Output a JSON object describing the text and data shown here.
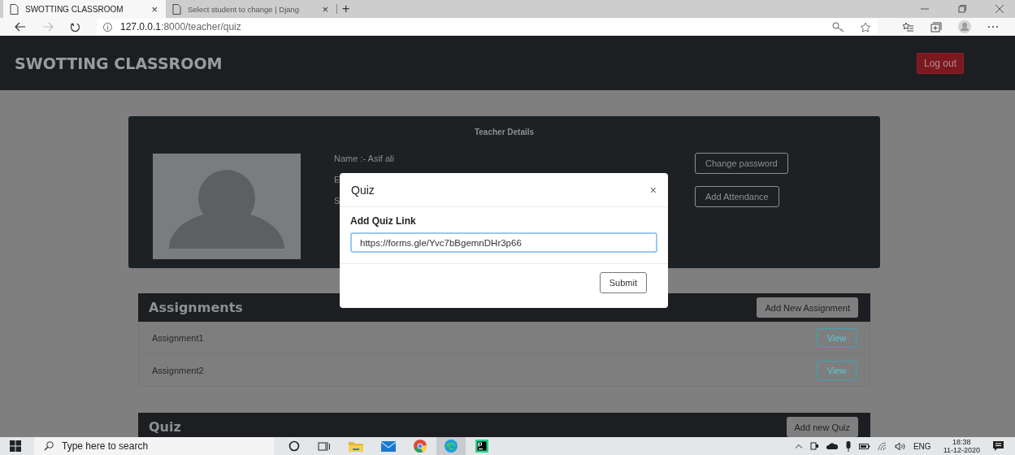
{
  "browser": {
    "tabs": [
      {
        "title": "SWOTTING CLASSROOM",
        "selected": true
      },
      {
        "title": "Select student to change | Djang",
        "selected": false
      }
    ],
    "close_tab": "×",
    "new_tab": "+",
    "address": {
      "host": "127.0.0.1",
      "path": ":8000/teacher/quiz"
    }
  },
  "navbar": {
    "brand": "SWOTTING CLASSROOM",
    "logout": "Log out"
  },
  "teacher": {
    "title": "Teacher Details",
    "details": [
      "Name :- Asif ali",
      "E",
      "S"
    ],
    "buttons": [
      "Change password",
      "Add Attendance"
    ]
  },
  "assignments": {
    "title": "Assignments",
    "add": "Add New Assignment",
    "rows": [
      {
        "name": "Assignment1",
        "action": "View"
      },
      {
        "name": "Assignment2",
        "action": "View"
      }
    ]
  },
  "quiz": {
    "title": "Quiz",
    "add": "Add new Quiz"
  },
  "modal": {
    "title": "Quiz",
    "close": "×",
    "label": "Add Quiz Link",
    "value": "https://forms.gle/Yvc7bBgemnDHr3p66",
    "submit": "Submit"
  },
  "taskbar": {
    "search": {
      "placeholder": "Type here to search"
    },
    "language": "ENG",
    "time": "18:38",
    "date": "11-12-2020"
  }
}
